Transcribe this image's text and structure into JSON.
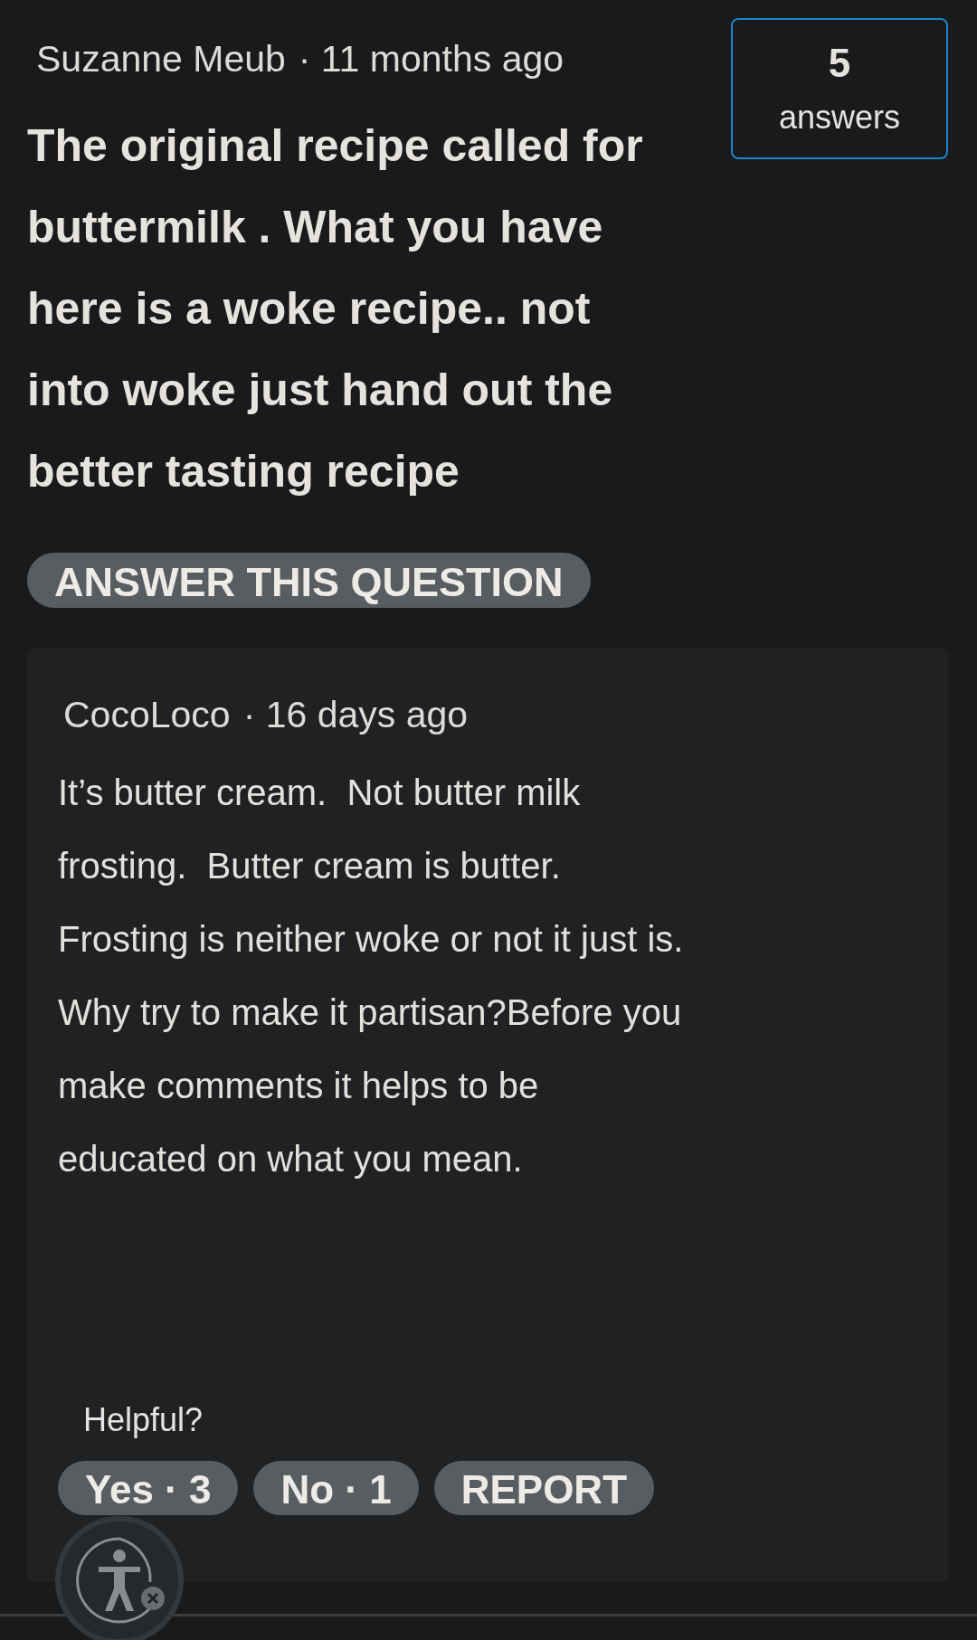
{
  "question": {
    "author": "Suzanne Meub",
    "age": "· 11 months ago",
    "answer_count": "5",
    "answer_count_label": "answers",
    "text": "The original recipe called for buttermilk . What you have here is a woke recipe.. not into woke just hand out the better tasting recipe",
    "answer_button": "ANSWER THIS QUESTION"
  },
  "answers": [
    {
      "author": "CocoLoco",
      "age": "· 16 days ago",
      "text": "It’s butter cream.  Not butter milk\nfrosting.  Butter cream is butter.\nFrosting is neither woke or not it just is.\nWhy try to make it partisan?Before you\nmake comments it helps to be\neducated on what you mean.",
      "helpful_label": "Helpful?",
      "votes": [
        "Yes · 3",
        "No · 1",
        "REPORT"
      ]
    }
  ]
}
